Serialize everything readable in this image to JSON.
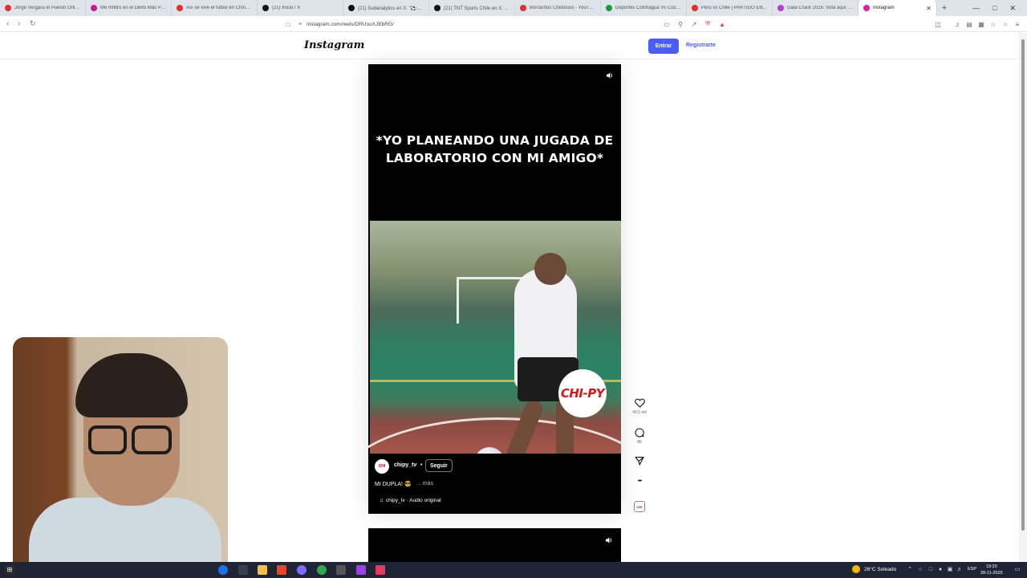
{
  "browser": {
    "tabs": [
      {
        "title": "Jorge Vergara el Puesto Onlaco...",
        "icon_color": "#e0312b"
      },
      {
        "title": "Me Infiltro en el Derbi Más Pe...",
        "icon_color": "#c9188f"
      },
      {
        "title": "Así se vive el fútbol en China - ...",
        "icon_color": "#e0312b"
      },
      {
        "title": "(21) Inicio / X",
        "icon_color": "#111111"
      },
      {
        "title": "(21) Sudanalytics en X: \"⚽...",
        "icon_color": "#111111"
      },
      {
        "title": "(21) TNT Sports Chile en X: \"😮...",
        "icon_color": "#111111"
      },
      {
        "title": "Borrachos Chistosos - YouTube",
        "icon_color": "#e0312b"
      },
      {
        "title": "Deportes Colchagua Vs Coco Co...",
        "icon_color": "#1a9c3a"
      },
      {
        "title": "Perú vs Chile | PARTIDO EN...",
        "icon_color": "#e0312b"
      },
      {
        "title": "Gala Crack 2025: Vota aquí po...",
        "icon_color": "#b43fd6"
      },
      {
        "title": "Instagram",
        "icon_color": "#d6249f",
        "active": true
      }
    ],
    "new_tab": "+",
    "window_controls": [
      "—",
      "□",
      "✕"
    ],
    "url": "instagram.com/reels/DRUouXJEbRG/"
  },
  "instagram": {
    "logo": "Instagram",
    "login_label": "Entrar",
    "signup_label": "Registrarte"
  },
  "reel": {
    "overlay_text": "*YO PLANEANDO UNA JUGADA DE LABORATORIO CON MI AMIGO*",
    "sticker_brand": "CHI-PY",
    "author": "chipy_tv",
    "author_dot": "•",
    "follow_label": "Seguir",
    "caption": "MI DUPLA! 😎",
    "caption_more": "... más",
    "audio": "chipy_tv · Audio original",
    "likes": "49,5 mil",
    "comments": "86",
    "more_label": "•••"
  },
  "taskbar": {
    "weather": "26°C  Soleado",
    "lang": "ESP",
    "time": "19:20",
    "date": "28-11-2025"
  },
  "colors": {
    "accent": "#4a5df9",
    "taskbar": "#1f2535"
  }
}
